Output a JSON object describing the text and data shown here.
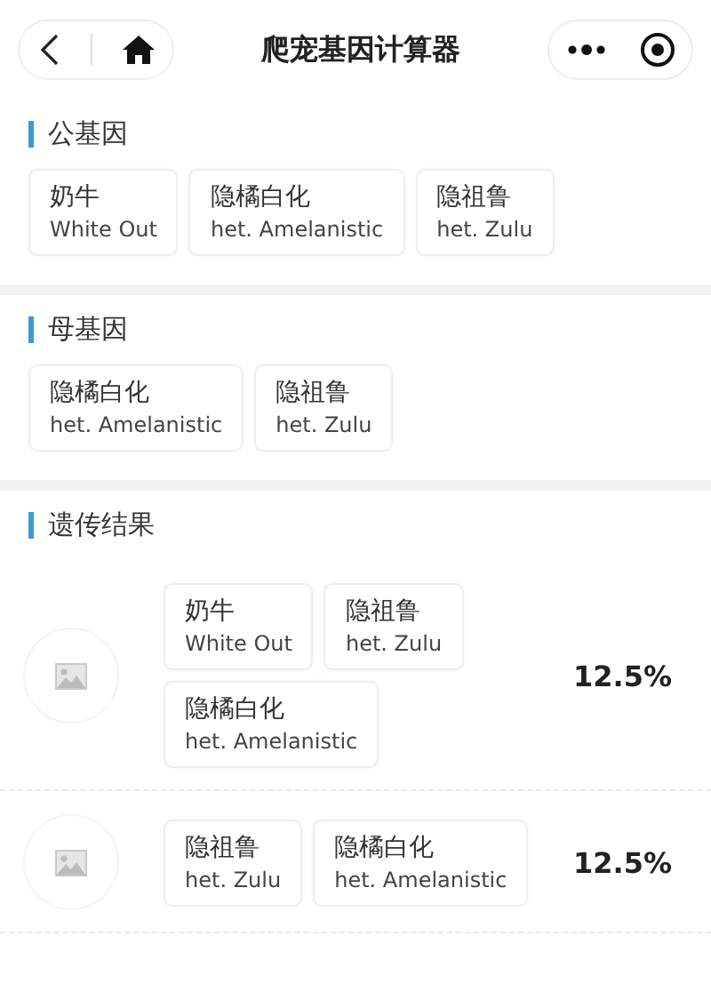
{
  "nav": {
    "title": "爬宠基因计算器"
  },
  "sections": [
    {
      "title": "公基因",
      "genes": [
        {
          "name": "奶牛",
          "en": "White Out"
        },
        {
          "name": "隐橘白化",
          "en": "het. Amelanistic"
        },
        {
          "name": "隐祖鲁",
          "en": "het. Zulu"
        }
      ]
    },
    {
      "title": "母基因",
      "genes": [
        {
          "name": "隐橘白化",
          "en": "het. Amelanistic"
        },
        {
          "name": "隐祖鲁",
          "en": "het. Zulu"
        }
      ]
    }
  ],
  "results": {
    "title": "遗传结果",
    "rows": [
      {
        "genes": [
          {
            "name": "奶牛",
            "en": "White Out"
          },
          {
            "name": "隐祖鲁",
            "en": "het. Zulu"
          },
          {
            "name": "隐橘白化",
            "en": "het. Amelanistic"
          }
        ],
        "percent": "12.5%"
      },
      {
        "genes": [
          {
            "name": "隐祖鲁",
            "en": "het. Zulu"
          },
          {
            "name": "隐橘白化",
            "en": "het. Amelanistic"
          }
        ],
        "percent": "12.5%"
      }
    ]
  }
}
